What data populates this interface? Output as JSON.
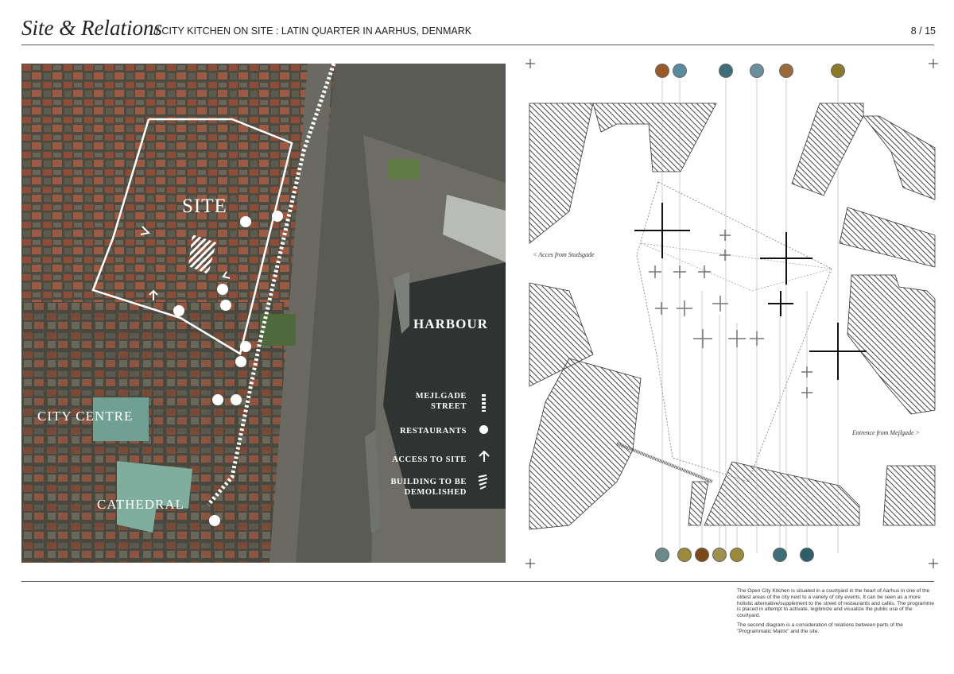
{
  "header": {
    "title": "Site & Relations",
    "subtitle": "// CITY KITCHEN ON SITE : LATIN QUARTER IN AARHUS, DENMARK",
    "page": "8 / 15"
  },
  "map": {
    "labels": {
      "site": "SITE",
      "harbour": "HARBOUR",
      "city_centre": "CITY CENTRE",
      "cathedral": "CATHEDRAL"
    },
    "legend": {
      "street": "MEJLGADE STREET",
      "street_line1": "MEJLGADE",
      "street_line2": "STREET",
      "restaurants": "RESTAURANTS",
      "access": "ACCESS TO SITE",
      "demolished": "BUILDING TO BE DEMOLISHED",
      "demolished_line1": "BUILDING TO BE",
      "demolished_line2": "DEMOLISHED"
    },
    "restaurant_icon": "fork-knife-icon",
    "access_icon": "arrow-up-icon"
  },
  "diagram": {
    "access_left": "< Acces from Studsgade",
    "access_right": "Entrence from Mejlgade >",
    "top_icon_colors": [
      "#9a5a2a",
      "#5a8aa0",
      "#3e6f78",
      "#6a90a0",
      "#9a6a3a",
      "#8a7a2a"
    ],
    "bottom_icon_colors": [
      "#6a8a8a",
      "#9a8a3a",
      "#7a4a1a",
      "#a09050",
      "#9a8a3a",
      "#3e6f78",
      "#2e5f68"
    ]
  },
  "footer": {
    "paragraph1": "The Open City Kitchen is situated in a courtyard in the heart of Aarhus in one of the oldest areas of the city next to a variety of city events. It can be seen as a more holistic alternative/supplement to the street of restaurants and cafés. The programme is placed in attempt to activate, legitimize and visualize the public use of the courtyard.",
    "paragraph2": "The second diagram is a consideration of relations between parts of the \"Programmatic Matrix\" and the site."
  }
}
